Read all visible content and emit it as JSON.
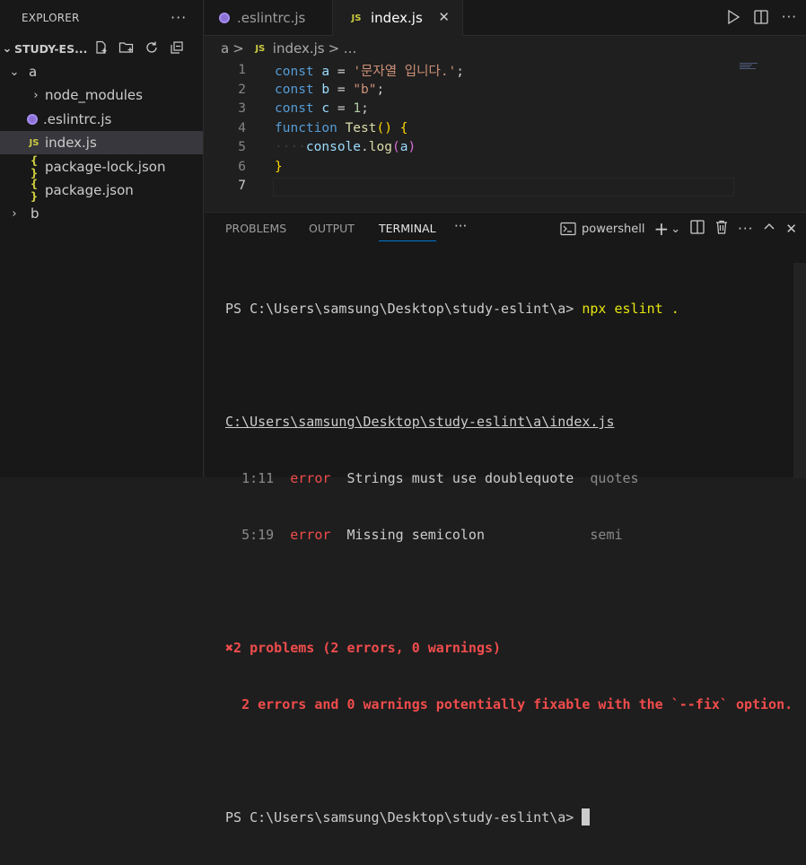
{
  "sidebar": {
    "title": "EXPLORER",
    "more": "···",
    "project": "STUDY-ES...",
    "tree": [
      {
        "label": "a",
        "kind": "folder-open"
      },
      {
        "label": "node_modules",
        "kind": "folder-closed"
      },
      {
        "label": ".eslintrc.js",
        "kind": "eslint"
      },
      {
        "label": "index.js",
        "kind": "js",
        "selected": true
      },
      {
        "label": "package-lock.json",
        "kind": "json"
      },
      {
        "label": "package.json",
        "kind": "json"
      },
      {
        "label": "b",
        "kind": "folder-closed"
      }
    ],
    "icons": {
      "js": "JS",
      "json": "{ }"
    }
  },
  "tabs": [
    {
      "label": ".eslintrc.js",
      "icon": "eslint-icon"
    },
    {
      "label": "index.js",
      "icon": "JS",
      "active": true
    }
  ],
  "breadcrumb": {
    "folder": "a",
    "sep": ">",
    "icon": "JS",
    "file": "index.js",
    "more": "> ..."
  },
  "editor": {
    "lines": [
      {
        "n": "1",
        "tokens": [
          {
            "t": "const",
            "c": "kw"
          },
          {
            "t": " a ",
            "c": "var"
          },
          {
            "t": "= ",
            "c": ""
          },
          {
            "t": "'문자열 입니다.'",
            "c": "str"
          },
          {
            "t": ";",
            "c": ""
          }
        ]
      },
      {
        "n": "2",
        "tokens": [
          {
            "t": "const",
            "c": "kw"
          },
          {
            "t": " b ",
            "c": "var"
          },
          {
            "t": "= ",
            "c": ""
          },
          {
            "t": "\"b\"",
            "c": "str"
          },
          {
            "t": ";",
            "c": ""
          }
        ]
      },
      {
        "n": "3",
        "tokens": [
          {
            "t": "const",
            "c": "kw"
          },
          {
            "t": " c ",
            "c": "var"
          },
          {
            "t": "= ",
            "c": ""
          },
          {
            "t": "1",
            "c": "num"
          },
          {
            "t": ";",
            "c": ""
          }
        ]
      },
      {
        "n": "4",
        "tokens": [
          {
            "t": "function",
            "c": "kw"
          },
          {
            "t": " ",
            "c": ""
          },
          {
            "t": "Test",
            "c": "fn"
          },
          {
            "t": "()",
            "c": "br1"
          },
          {
            "t": " ",
            "c": ""
          },
          {
            "t": "{",
            "c": "br1"
          }
        ]
      },
      {
        "n": "5",
        "tokens": [
          {
            "t": "····",
            "c": "ws"
          },
          {
            "t": "console",
            "c": "var"
          },
          {
            "t": ".",
            "c": ""
          },
          {
            "t": "log",
            "c": "fn"
          },
          {
            "t": "(",
            "c": "br2"
          },
          {
            "t": "a",
            "c": "var"
          },
          {
            "t": ")",
            "c": "br2"
          }
        ]
      },
      {
        "n": "6",
        "tokens": [
          {
            "t": "}",
            "c": "br1"
          }
        ]
      },
      {
        "n": "7",
        "tokens": [],
        "active": true
      }
    ]
  },
  "panel": {
    "tabs": [
      "PROBLEMS",
      "OUTPUT",
      "TERMINAL"
    ],
    "more": "···",
    "shell": "powershell"
  },
  "terminal": {
    "prompt1": "PS C:\\Users\\samsung\\Desktop\\study-eslint\\a> ",
    "cmd": "npx eslint .",
    "file": "C:\\Users\\samsung\\Desktop\\study-eslint\\a\\index.js",
    "errors": [
      {
        "pos": "1:11",
        "level": "error",
        "msg": "Strings must use doublequote",
        "rule": "quotes"
      },
      {
        "pos": "5:19",
        "level": "error",
        "msg": "Missing semicolon",
        "rule": "semi"
      }
    ],
    "summary_icon": "✖",
    "summary": "2 problems (2 errors, 0 warnings)",
    "fixable": "2 errors and 0 warnings potentially fixable with the `--fix` option.",
    "prompt2": "PS C:\\Users\\samsung\\Desktop\\study-eslint\\a> "
  }
}
